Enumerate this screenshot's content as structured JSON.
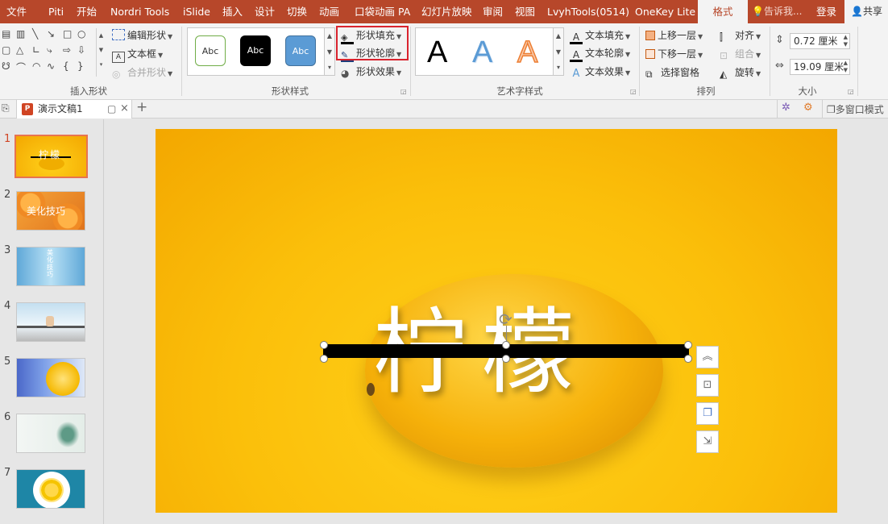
{
  "menubar": {
    "items": [
      "文件",
      "Piti",
      "开始",
      "Nordri Tools",
      "iSlide",
      "插入",
      "设计",
      "切换",
      "动画",
      "口袋动画 PA",
      "幻灯片放映",
      "审阅",
      "视图",
      "LvyhTools(0514)",
      "OneKey Lite"
    ],
    "active_tab": "格式",
    "tell_me": "告诉我...",
    "login": "登录",
    "share": "共享"
  },
  "ribbon": {
    "insert_shapes": {
      "edit_shape": "编辑形状",
      "text_box": "文本框",
      "merge_shapes": "合并形状",
      "label": "插入形状"
    },
    "shape_styles": {
      "samples": [
        "Abc",
        "Abc",
        "Abc"
      ],
      "fill": "形状填充",
      "outline": "形状轮廓",
      "effects": "形状效果",
      "label": "形状样式"
    },
    "wordart": {
      "samples": [
        "A",
        "A",
        "A"
      ],
      "text_fill": "文本填充",
      "text_outline": "文本轮廓",
      "text_effects": "文本效果",
      "label": "艺术字样式"
    },
    "arrange": {
      "bring_forward": "上移一层",
      "send_backward": "下移一层",
      "selection_pane": "选择窗格",
      "align": "对齐",
      "group": "组合",
      "rotate": "旋转",
      "label": "排列"
    },
    "size": {
      "height": "0.72 厘米",
      "width": "19.09 厘米",
      "label": "大小"
    }
  },
  "tabbar": {
    "doc_name": "演示文稿1",
    "multi_window": "多窗口模式"
  },
  "thumbnails": {
    "numbers": [
      "1",
      "2",
      "3",
      "4",
      "5",
      "6",
      "7"
    ],
    "slide1_text": "柠檬",
    "slide2_text": "美化技巧",
    "slide3_text": "美化技巧"
  },
  "slide": {
    "title": "柠檬"
  },
  "colors": {
    "accent": "#b7472a",
    "slide_bg": "#fbbf0a",
    "highlight": "#d9232e"
  }
}
